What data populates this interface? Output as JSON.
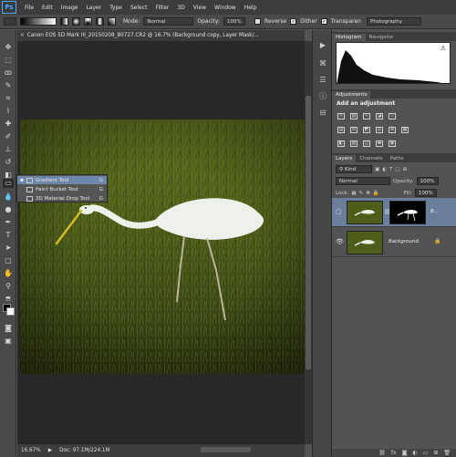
{
  "menubar": {
    "logo": "Ps",
    "items": [
      "File",
      "Edit",
      "Image",
      "Layer",
      "Type",
      "Select",
      "Filter",
      "3D",
      "View",
      "Window",
      "Help"
    ]
  },
  "options": {
    "mode_label": "Mode:",
    "mode_value": "Normal",
    "opacity_label": "Opacity:",
    "opacity_value": "100%",
    "reverse_label": "Reverse",
    "dither_label": "Dither",
    "transparency_label": "Transparen",
    "workspace": "Photography"
  },
  "document": {
    "tab_title": "Canon EOS 5D Mark III_20150208_80727.CR2 @ 16.7% (Background copy, Layer Mask/...",
    "zoom": "16.67%",
    "doc_size": "Doc: 97.1M/224.1M"
  },
  "flyout": {
    "items": [
      {
        "label": "Gradient Tool",
        "key": "G",
        "selected": true
      },
      {
        "label": "Paint Bucket Tool",
        "key": "G",
        "selected": false
      },
      {
        "label": "3D Material Drop Tool",
        "key": "G",
        "selected": false
      }
    ]
  },
  "panels": {
    "top_tabs": [
      "Histogram",
      "Navigator"
    ],
    "adjustments_tab": "Adjustments",
    "adjustments_title": "Add an adjustment",
    "layers_tabs": [
      "Layers",
      "Channels",
      "Paths"
    ],
    "kind_label": "Kind",
    "blend_mode": "Normal",
    "opacity_label": "Opacity:",
    "opacity_value": "100%",
    "lock_label": "Lock:",
    "fill_label": "Fill:",
    "fill_value": "100%",
    "layers": [
      {
        "name": "B...",
        "selected": true,
        "visible": false
      },
      {
        "name": "Background",
        "selected": false,
        "visible": true
      }
    ]
  },
  "colors": {
    "accent_selection": "#6d87a9",
    "ps_blue": "#4aa8ff"
  }
}
